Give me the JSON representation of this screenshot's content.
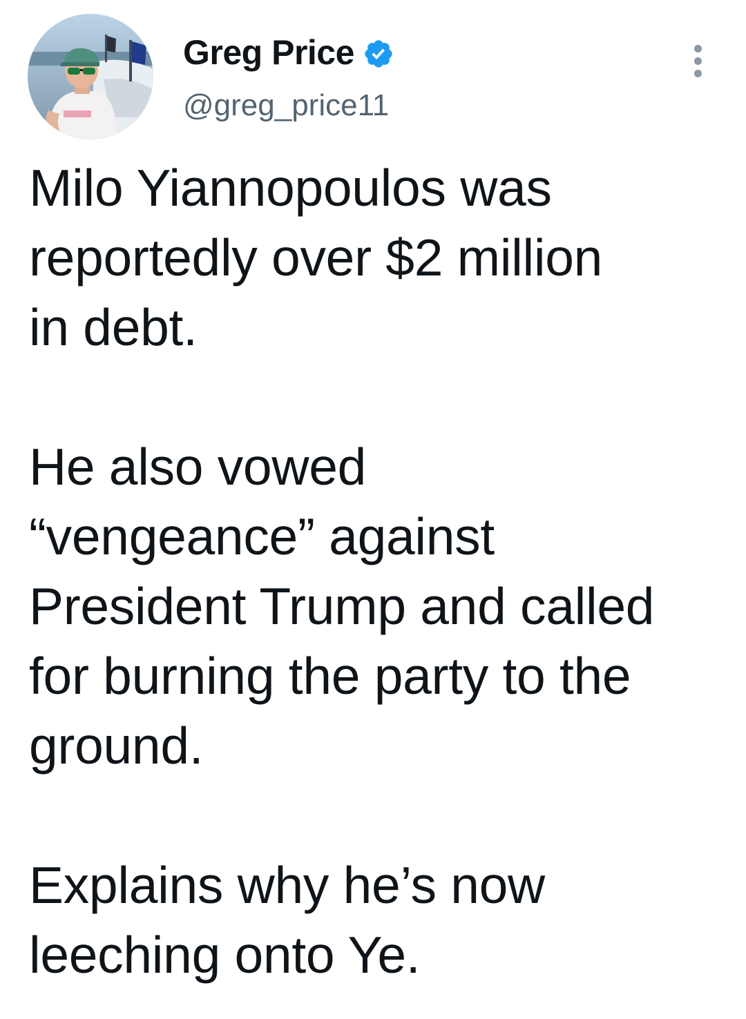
{
  "author": {
    "display_name": "Greg Price",
    "handle": "@greg_price11",
    "verified": true,
    "verified_color": "#1d9bf0"
  },
  "more_icon": "more-vertical-icon",
  "tweet": {
    "paragraphs": [
      [
        "Milo Yiannopoulos was",
        "reportedly over $2 million",
        "in debt."
      ],
      [
        "He also vowed",
        "“vengeance” against",
        "President Trump and called",
        "for burning the party to the",
        "ground."
      ],
      [
        "Explains why he’s now",
        "leeching onto Ye."
      ]
    ]
  }
}
